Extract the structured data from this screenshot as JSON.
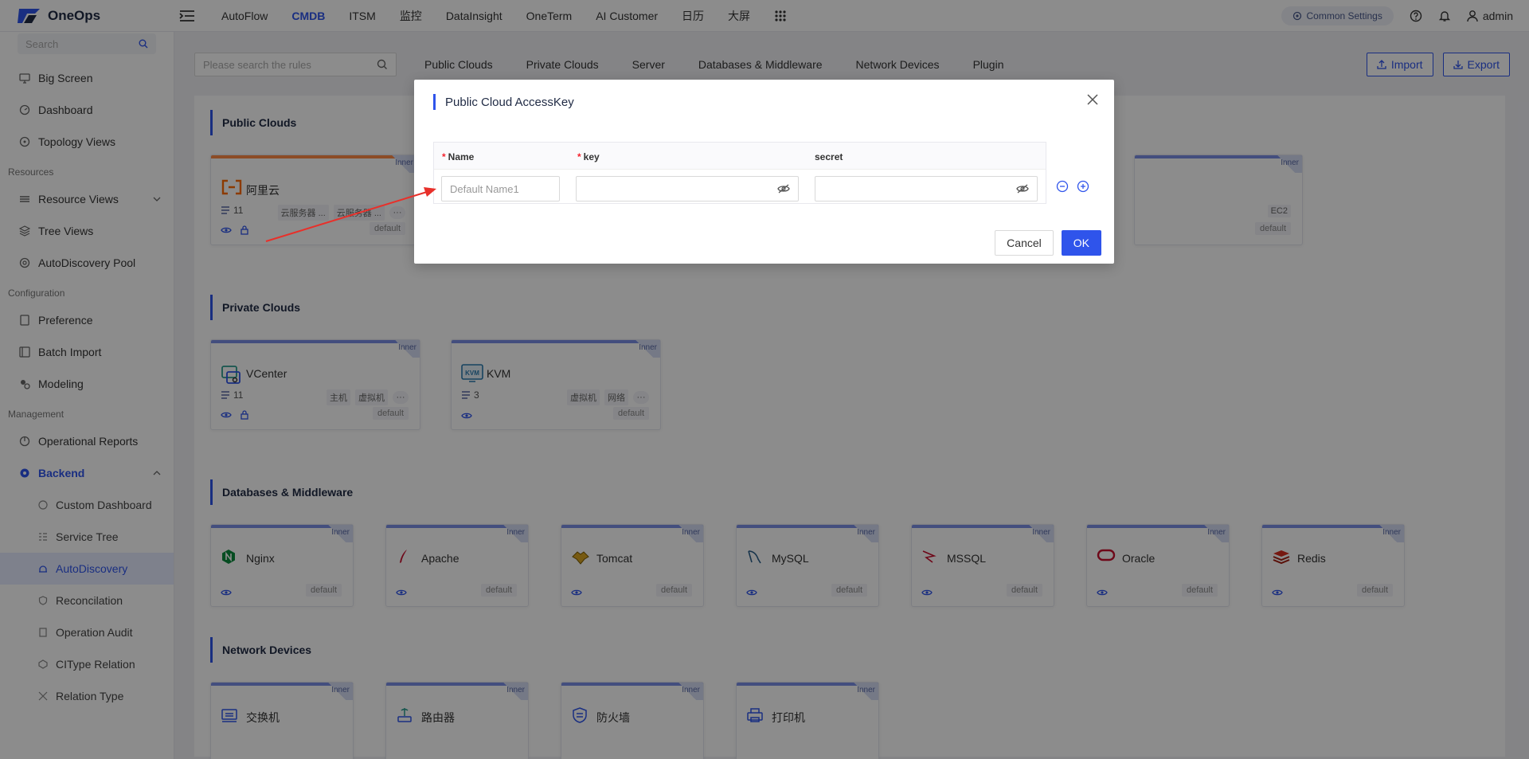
{
  "app": {
    "logo_text": "OneOps"
  },
  "topnav": {
    "items": [
      "AutoFlow",
      "CMDB",
      "ITSM",
      "监控",
      "DataInsight",
      "OneTerm",
      "AI Customer",
      "日历",
      "大屏"
    ],
    "active": "CMDB",
    "common_settings": "Common Settings",
    "user": "admin"
  },
  "sidebar": {
    "search_placeholder": "Search",
    "items_top": [
      "Big Screen",
      "Dashboard",
      "Topology Views"
    ],
    "group_resources": "Resources",
    "items_resources": [
      "Resource Views",
      "Tree Views",
      "AutoDiscovery Pool"
    ],
    "group_configuration": "Configuration",
    "items_configuration": [
      "Preference",
      "Batch Import",
      "Modeling"
    ],
    "group_management": "Management",
    "item_reports": "Operational Reports",
    "backend": "Backend",
    "backend_items": [
      "Custom Dashboard",
      "Service Tree",
      "AutoDiscovery",
      "Reconcilation",
      "Operation Audit",
      "CIType Relation",
      "Relation Type"
    ],
    "active": "AutoDiscovery"
  },
  "toolbar": {
    "search_placeholder": "Please search the rules",
    "tabs": [
      "Public Clouds",
      "Private Clouds",
      "Server",
      "Databases & Middleware",
      "Network Devices",
      "Plugin"
    ],
    "import": "Import",
    "export": "Export"
  },
  "sections": {
    "public": "Public Clouds",
    "private": "Private Clouds",
    "db": "Databases & Middleware",
    "network": "Network Devices"
  },
  "card_common": {
    "inner": "Inner",
    "default": "default"
  },
  "public_cards": [
    {
      "name": "阿里云",
      "count": "11",
      "tags": [
        "云服务器 ...",
        "云服务器 ..."
      ]
    },
    {
      "partial_tag": "EC2"
    }
  ],
  "private_cards": [
    {
      "name": "VCenter",
      "count": "11",
      "tags": [
        "主机",
        "虚拟机"
      ]
    },
    {
      "name": "KVM",
      "count": "3",
      "tags": [
        "虚拟机",
        "网络"
      ]
    }
  ],
  "db_cards": [
    "Nginx",
    "Apache",
    "Tomcat",
    "MySQL",
    "MSSQL",
    "Oracle",
    "Redis"
  ],
  "network_cards": [
    "交换机",
    "路由器",
    "防火墙",
    "打印机"
  ],
  "modal": {
    "title": "Public Cloud AccessKey",
    "col_name": "Name",
    "col_key": "key",
    "col_secret": "secret",
    "name_placeholder": "Default Name1",
    "cancel": "Cancel",
    "ok": "OK"
  },
  "colors": {
    "accent": "#2f54eb",
    "annotation": "#e8302a"
  }
}
